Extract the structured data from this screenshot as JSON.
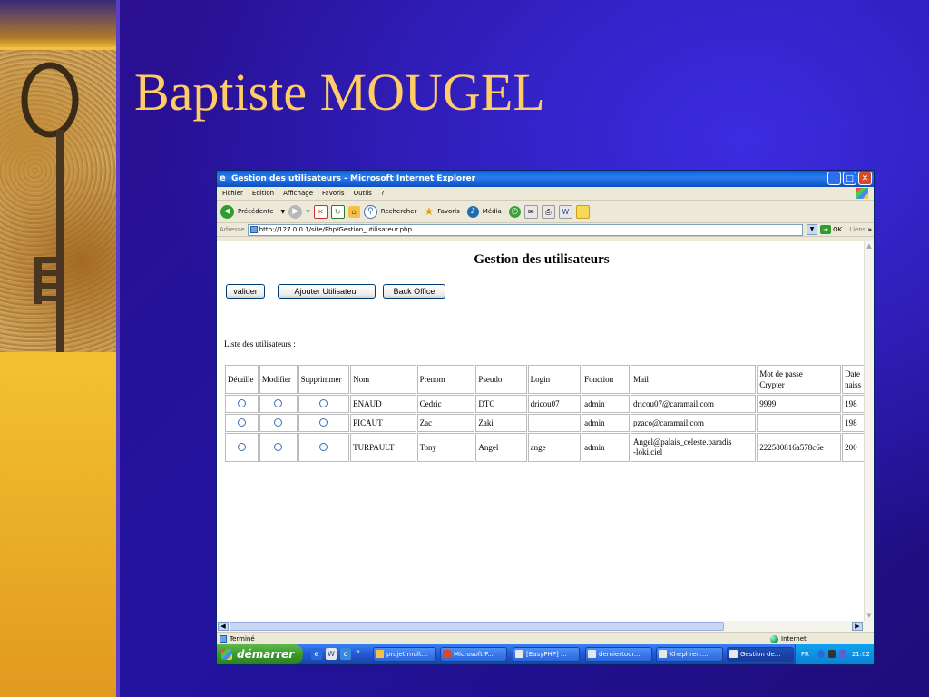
{
  "slide": {
    "title": "Baptiste MOUGEL"
  },
  "window": {
    "title": "Gestion des utilisateurs - Microsoft Internet Explorer",
    "minimize": "_",
    "maximize": "□",
    "close": "✕"
  },
  "menu": [
    "Fichier",
    "Edition",
    "Affichage",
    "Favoris",
    "Outils",
    "?"
  ],
  "toolbar": {
    "back": "Précédente",
    "search": "Rechercher",
    "favorites": "Favoris",
    "media": "Média"
  },
  "address": {
    "label": "Adresse",
    "url": "http://127.0.0.1/site/Php/Gestion_utilisateur.php",
    "go": "OK",
    "links": "Liens",
    "more": "»"
  },
  "page": {
    "heading": "Gestion des utilisateurs",
    "buttons": {
      "valider": "valider",
      "ajouter": "Ajouter Utilisateur",
      "back_office": "Back Office"
    },
    "list_label": "Liste des utilisateurs :",
    "table": {
      "headers": [
        "Détaille",
        "Modifier",
        "Supprimmer",
        "Nom",
        "Prenom",
        "Pseudo",
        "Login",
        "Fonction",
        "Mail",
        "Mot de passe Crypter",
        "Date naiss"
      ],
      "header_mdp_line1": "Mot de passe",
      "header_mdp_line2": "Crypter",
      "header_date_line1": "Date",
      "header_date_line2": "naiss",
      "rows": [
        {
          "nom": "ENAUD",
          "prenom": "Cedric",
          "pseudo": "DTC",
          "login": "dricou07",
          "fonction": "admin",
          "mail": "dricou07@caramail.com",
          "mail2": "",
          "mdp": "9999",
          "date": "198"
        },
        {
          "nom": "PICAUT",
          "prenom": "Zac",
          "pseudo": "Zaki",
          "login": "",
          "fonction": "admin",
          "mail": "pzaco@caramail.com",
          "mail2": "",
          "mdp": "",
          "date": "198"
        },
        {
          "nom": "TURPAULT",
          "prenom": "Tony",
          "pseudo": "Angel",
          "login": "ange",
          "fonction": "admin",
          "mail": "Angel@palais_celeste.paradis",
          "mail2": "-loki.ciel",
          "mdp": "222580816a578c6e",
          "date": "200"
        }
      ]
    }
  },
  "status": {
    "text": "Terminé",
    "zone": "Internet"
  },
  "taskbar": {
    "start": "démarrer",
    "more": "»",
    "tasks": [
      "projet mult...",
      "Microsoft P...",
      "[EasyPHP] ...",
      "derniertour...",
      "Khephren....",
      "Gestion de..."
    ],
    "lang": "FR",
    "clock": "21:02"
  },
  "colors": {
    "slide_bg": "#2a1296",
    "title": "#ffcc66",
    "xp_blue": "#245edb",
    "start_green": "#3a9a2e"
  }
}
